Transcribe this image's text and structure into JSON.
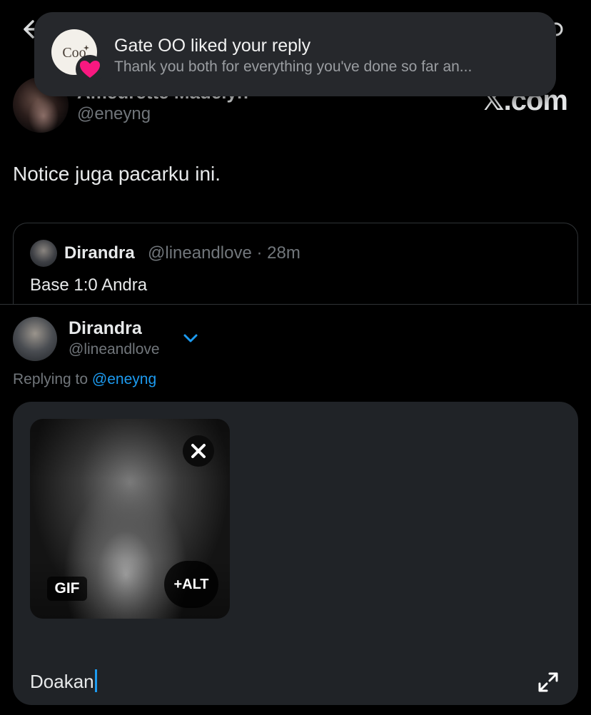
{
  "header": {
    "back_icon": "arrow-left-icon",
    "brand": ".com"
  },
  "notification": {
    "title": "Gate OO liked your reply",
    "body": "Thank you both for everything you've done so far an...",
    "avatar_text": "Coo",
    "badge_icon": "heart-icon",
    "badge_color": "#f91880"
  },
  "original_tweet": {
    "display_name": "Ameurette Madelyn",
    "handle": "@eneyng",
    "text": "Notice juga pacarku ini."
  },
  "quoted_tweet": {
    "display_name": "Dirandra",
    "meta": "@lineandlove · 28m",
    "text": "Base 1:0 Andra"
  },
  "compose": {
    "display_name": "Dirandra",
    "handle": "@lineandlove",
    "replying_prefix": "Replying to ",
    "replying_handle": "@eneyng",
    "gif_badge": "GIF",
    "alt_label": "+ALT",
    "input_value": "Doakan",
    "accent_color": "#1d9bf0"
  }
}
